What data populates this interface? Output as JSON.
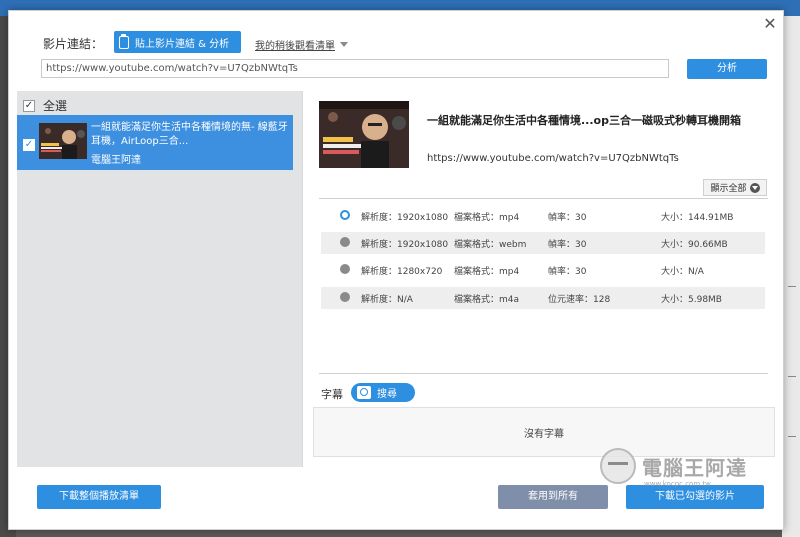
{
  "header": {
    "url_label": "影片連結：",
    "paste_button": "貼上影片連結 & 分析",
    "history_link": "我的稍後觀看清單",
    "url_value": "https://www.youtube.com/watch?v=U7QzbNWtqTs",
    "analyze_button": "分析"
  },
  "list": {
    "select_all": "全選",
    "items": [
      {
        "title": "一組就能滿足你生活中各種情境的無- 線藍牙耳機，AirLoop三合...",
        "channel": "電腦王阿達",
        "checked": true
      }
    ]
  },
  "detail": {
    "title": "一組就能滿足你生活中各種情境...op三合一磁吸式秒轉耳機開箱",
    "url": "https://www.youtube.com/watch?v=U7QzbNWtqTs",
    "show_all": "顯示全部",
    "formats": [
      {
        "res": "解析度：1920x1080",
        "fmt": "檔案格式：mp4",
        "rate": "幀率：30",
        "size": "大小：144.91MB",
        "selected": true
      },
      {
        "res": "解析度：1920x1080",
        "fmt": "檔案格式：webm",
        "rate": "幀率：30",
        "size": "大小：90.66MB",
        "selected": false
      },
      {
        "res": "解析度：1280x720",
        "fmt": "檔案格式：mp4",
        "rate": "幀率：30",
        "size": "大小：N/A",
        "selected": false
      },
      {
        "res": "解析度：N/A",
        "fmt": "檔案格式：m4a",
        "rate": "位元速率：128",
        "size": "大小：5.98MB",
        "selected": false
      }
    ],
    "subtitle_label": "字幕",
    "subtitle_search": "搜尋",
    "no_subtitle": "沒有字幕"
  },
  "footer": {
    "download_playlist": "下載整個播放清單",
    "apply_all": "套用到所有",
    "download_selected": "下載已勾選的影片"
  },
  "watermark": {
    "brand": "電腦王阿達",
    "domain": "www.kocpc.com.tw"
  },
  "colors": {
    "accent": "#2e8ee0",
    "selected_item": "#3d8fe0",
    "panel": "#e2e3e5",
    "apply_button": "#7f8fa9"
  }
}
